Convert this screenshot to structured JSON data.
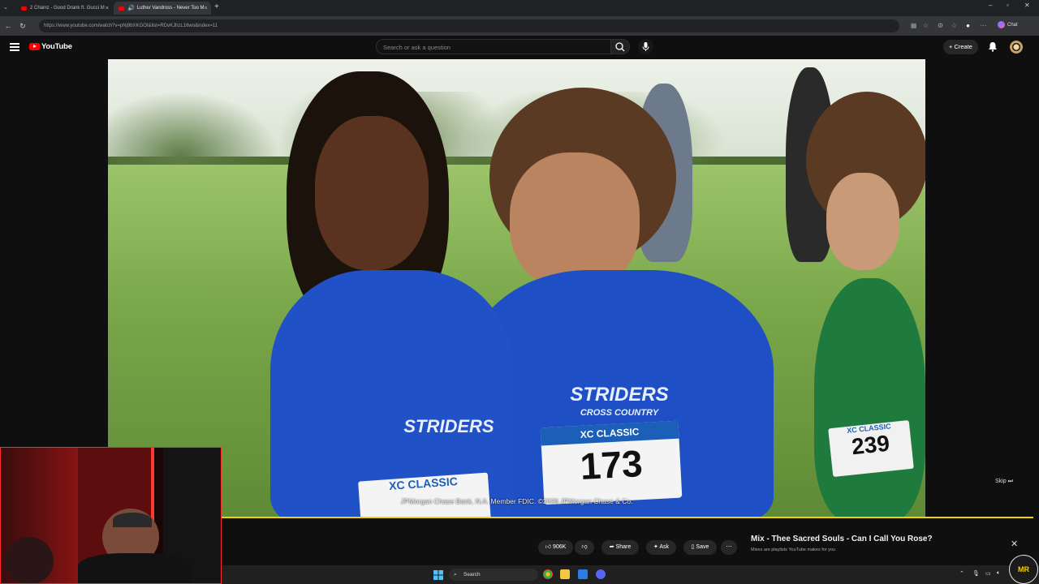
{
  "browser": {
    "tabs": [
      {
        "title": "2 Chainz - Good Drank ft. Gucci M"
      },
      {
        "title": "Luther Vandross - Never Too M"
      }
    ],
    "url": "https://www.youtube.com/watch?v=pNj9bXKGOI&list=RDvKJhzL16wo&index=11",
    "new_tab_icon": "plus-icon",
    "chat_label": "Chat"
  },
  "youtube": {
    "logo_text": "YouTube",
    "search_placeholder": "Search or ask a question",
    "create_label": "Create"
  },
  "video": {
    "caption": "JPMorgan Chase Bank, N.A. Member FDIC. ©2026 JPMorgan Chase & Co.",
    "skip_label": "Skip",
    "progress_fraction": 1.0,
    "jersey_text": [
      "STRIDERS",
      "CROSS COUNTRY",
      "XC CLASSIC",
      "173",
      "239"
    ]
  },
  "actions": {
    "like_count": "906K",
    "share_label": "Share",
    "ask_label": "Ask",
    "save_label": "Save"
  },
  "mix": {
    "title": "Mix - Thee Sacred Souls - Can I Call You Rose?",
    "subtitle": "Mixes are playlists YouTube makes for you"
  },
  "taskbar": {
    "search_label": "Search"
  },
  "colors": {
    "youtube_red": "#ff0000",
    "progress_yellow": "#f2d200",
    "webcam_border": "#ff2a2a"
  }
}
